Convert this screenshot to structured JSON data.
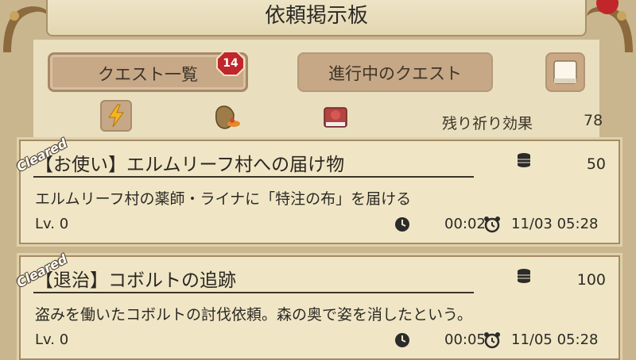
{
  "header": {
    "title": "依頼掲示板"
  },
  "tabs": {
    "quest_list": "クエスト一覧",
    "in_progress": "進行中のクエスト",
    "quest_count": "14"
  },
  "filters": [
    "lightning-icon",
    "bag-icon",
    "book-icon"
  ],
  "prayer": {
    "label": "残り祈り効果",
    "value": "78"
  },
  "quests": [
    {
      "status": "Cleared",
      "title": "【お使い】エルムリーフ村への届け物",
      "description": "エルムリーフ村の薬師・ライナに「特注の布」を届ける",
      "level": "Lv. 0",
      "reward": "50",
      "duration": "00:02",
      "deadline": "11/03 05:28"
    },
    {
      "status": "Cleared",
      "title": "【退治】コボルトの追跡",
      "description": "盗みを働いたコボルトの討伐依頼。森の奥で姿を消したという。",
      "level": "Lv. 0",
      "reward": "100",
      "duration": "00:05",
      "deadline": "11/05 05:28"
    }
  ],
  "colors": {
    "badge": "#c0262a",
    "panel": "#e9dfbf",
    "card": "#f0e6c6"
  }
}
